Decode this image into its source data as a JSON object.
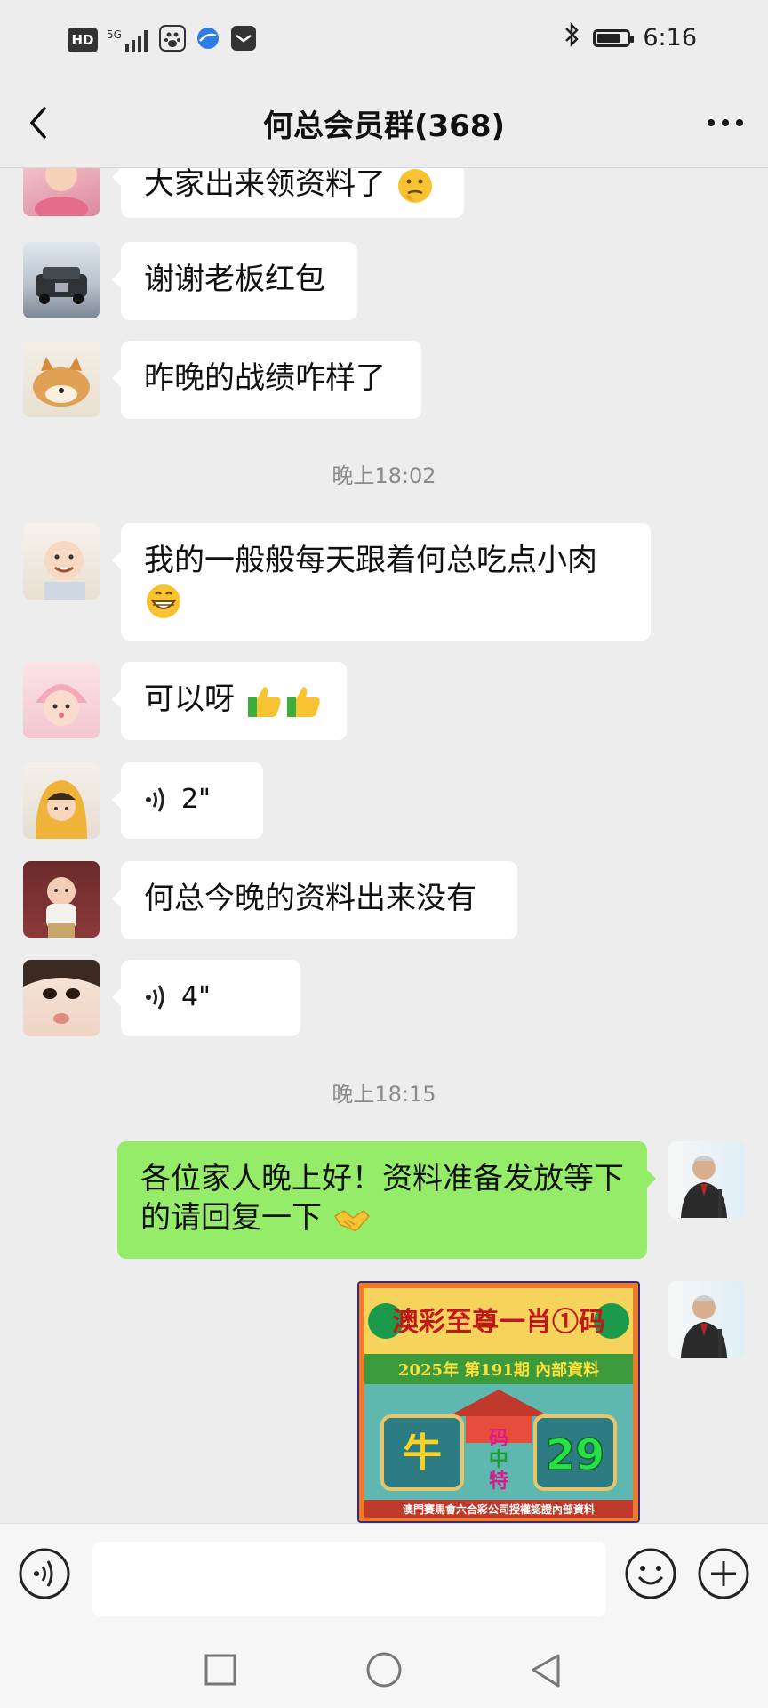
{
  "status_bar": {
    "hd": "HD",
    "network": "5G",
    "time": "6:16",
    "battery_level": 0.8,
    "icons": [
      "hd-icon",
      "signal-icon",
      "baidu-icon",
      "browser-icon",
      "message-icon",
      "bluetooth-icon",
      "battery-icon"
    ]
  },
  "header": {
    "title": "何总会员群(368)",
    "back_icon": "chevron-left-icon",
    "more_icon": "more-dots-icon"
  },
  "messages": [
    {
      "side": "left",
      "avatar": "avatar-baby-pink",
      "text": "大家出来领资料了",
      "emoji": "thinking-face"
    },
    {
      "side": "left",
      "avatar": "avatar-car",
      "text": "谢谢老板红包"
    },
    {
      "side": "left",
      "avatar": "avatar-dog",
      "text": "昨晚的战绩咋样了"
    },
    {
      "timestamp": "晚上18:02"
    },
    {
      "side": "left",
      "avatar": "avatar-baby-smile",
      "text": "我的一般般每天跟着何总吃点小肉",
      "emoji": "grinning-face"
    },
    {
      "side": "left",
      "avatar": "avatar-baby-hat",
      "text": "可以呀",
      "emoji": "thumbs-up x2"
    },
    {
      "side": "left",
      "avatar": "avatar-child-yellow",
      "voice": "2\""
    },
    {
      "side": "left",
      "avatar": "avatar-baby-chair",
      "text": "何总今晚的资料出来没有"
    },
    {
      "side": "left",
      "avatar": "avatar-child-face",
      "voice": "4\""
    },
    {
      "timestamp": "晚上18:15"
    },
    {
      "side": "right",
      "avatar": "avatar-man-podium",
      "text": "各位家人晚上好！资料准备发放等下的请回复一下",
      "emoji": "handshake"
    },
    {
      "side": "right",
      "avatar": "avatar-man-podium",
      "image": {
        "title": "澳彩至尊一肖①码",
        "subtitle": "2025年 第191期 內部資料",
        "left_glyph": "牛",
        "vertical": "码中特",
        "number": "29",
        "footer": "澳門賽馬會六合彩公司授權認證內部資料"
      }
    }
  ],
  "input_bar": {
    "voice_icon": "voice-icon",
    "emoji_icon": "emoji-icon",
    "plus_icon": "plus-icon"
  },
  "system_nav": {
    "icons": [
      "square-icon",
      "circle-icon",
      "back-triangle-icon"
    ]
  }
}
